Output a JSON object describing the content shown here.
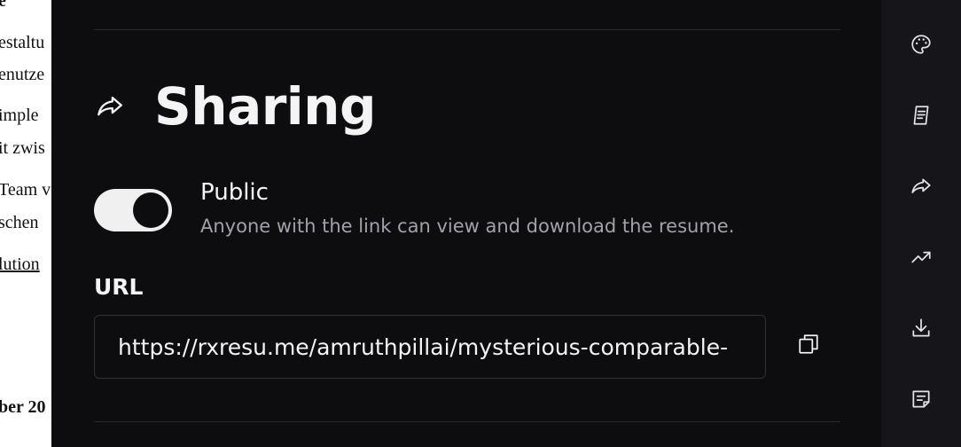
{
  "resume_background": {
    "lines": [
      "e",
      "estaltu",
      "enutze",
      "imple",
      "it zwis",
      "Team v",
      "schen",
      "lution",
      "ber 20"
    ]
  },
  "section": {
    "title": "Sharing",
    "icon": "share-icon"
  },
  "public_toggle": {
    "label": "Public",
    "description": "Anyone with the link can view and download the resume.",
    "enabled": true
  },
  "url": {
    "label": "URL",
    "value": "https://rxresu.me/amruthpillai/mysterious-comparable-",
    "copy_icon": "copy-icon"
  },
  "sidebar": {
    "items": [
      {
        "icon": "palette-icon"
      },
      {
        "icon": "notebook-icon"
      },
      {
        "icon": "share-icon"
      },
      {
        "icon": "trending-up-icon"
      },
      {
        "icon": "download-icon"
      },
      {
        "icon": "note-icon"
      }
    ]
  },
  "colors": {
    "background": "#0d0d10",
    "sidebar": "#16161a",
    "text": "#f4f4f5",
    "muted": "#a1a1aa"
  }
}
